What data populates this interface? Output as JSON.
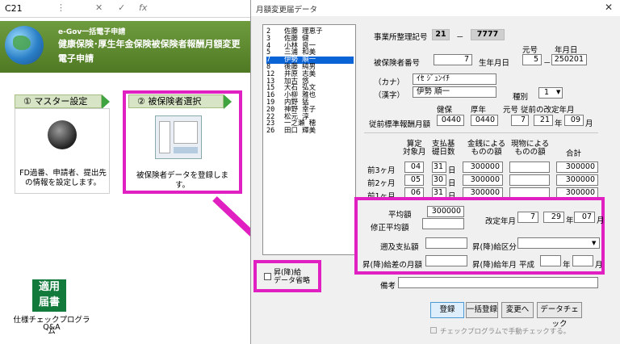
{
  "excel": {
    "cell_ref": "C21",
    "icons": [
      "dropdown-icon",
      "cancel-x-icon",
      "enter-check-icon",
      "function-fx-icon"
    ],
    "icon_glyphs": [
      "⋮",
      "✕",
      "✓",
      "fx"
    ]
  },
  "banner": {
    "line1": "e-Gov一括電子申請",
    "line2": "健康保険･厚生年金保険被保険者報酬月額変更",
    "line3": "電子申請"
  },
  "steps": [
    {
      "label": "① マスター設定",
      "desc": "FD過番、申請者、提出先の情報を設定します。"
    },
    {
      "label": "② 被保険者選択",
      "desc": "被保険者データを登録します。"
    }
  ],
  "kouyou": {
    "line1": "適用",
    "line2": "届書",
    "caption1": "仕様チェックプログラム",
    "caption2": "Q&A"
  },
  "dialog": {
    "title": "月額変更届データ",
    "close": "✕",
    "list": [
      {
        "no": "2",
        "name": "佐藤 理恵子"
      },
      {
        "no": "3",
        "name": "佐藤 健"
      },
      {
        "no": "4",
        "name": "小林 良一"
      },
      {
        "no": "5",
        "name": "三浦 和美"
      },
      {
        "no": "7",
        "name": "伊勢 順一",
        "selected": true
      },
      {
        "no": "8",
        "name": "後藤 純男"
      },
      {
        "no": "12",
        "name": "井原 志美"
      },
      {
        "no": "13",
        "name": "加古 悠"
      },
      {
        "no": "15",
        "name": "大石 弘文"
      },
      {
        "no": "16",
        "name": "小柳 雅也"
      },
      {
        "no": "19",
        "name": "内野 猛"
      },
      {
        "no": "20",
        "name": "神野 幸子"
      },
      {
        "no": "22",
        "name": "松元 淳"
      },
      {
        "no": "23",
        "name": "一之瀬 穂"
      },
      {
        "no": "26",
        "name": "田口 輝美"
      }
    ],
    "office_label": "事業所整理記号",
    "office_code1": "21",
    "office_dash": "－",
    "office_code2": "7777",
    "ins_no_label": "被保険者番号",
    "ins_no": "7",
    "birth_label": "生年月日",
    "era_header": "元号",
    "ymd_header": "年月日",
    "era": "5",
    "dash": "－",
    "birth": "250201",
    "kana_label": "（カナ）",
    "kana": "ｲｾ ｼﾞｭﾝｲﾁ",
    "kanji_label": "（漢字）",
    "kanji": "伊勢 順一",
    "shubetsu_label": "種別",
    "shubetsu": "1",
    "prev_label": "従前標準報酬月額",
    "hdr_kenpo": "健保",
    "hdr_kosei": "厚年",
    "kenpo": "0440",
    "kosei": "0440",
    "hdr_era_change": "元号 従前の改定年月",
    "prev_era": "7",
    "prev_year": "21",
    "nen": "年",
    "prev_month": "09",
    "gatsu": "月",
    "col_month": "算定\n対象月",
    "col_days": "支払基\n礎日数",
    "col_cash": "金銭による\nものの額",
    "col_kind": "現物による\nものの額",
    "col_total": "合計",
    "rows": [
      {
        "label": "前3ヶ月",
        "month": "04",
        "days": "31",
        "day_unit": "日",
        "cash": "300000",
        "kind": "",
        "total": "300000"
      },
      {
        "label": "前2ヶ月",
        "month": "05",
        "days": "30",
        "day_unit": "日",
        "cash": "300000",
        "kind": "",
        "total": "300000"
      },
      {
        "label": "前1ヶ月",
        "month": "06",
        "days": "31",
        "day_unit": "日",
        "cash": "300000",
        "kind": "",
        "total": "300000"
      }
    ],
    "avg_label": "平均額",
    "avg": "300000",
    "mod_avg_label": "修正平均額",
    "mod_avg": "",
    "change_label": "改定年月",
    "change_era": "7",
    "change_year": "29",
    "change_month": "07",
    "retro_label": "遡及支払額",
    "retro": "",
    "raise_type_label": "昇(降)給区分",
    "raise_type": "",
    "raise_diff_label": "昇(降)給差の月額",
    "raise_diff": "",
    "raise_month_label": "昇(降)給年月",
    "heisei": "平成",
    "raise_year": "",
    "raise_month": "",
    "note_label": "備考",
    "note": "",
    "omit_label": "昇(降)給\nデータ省略",
    "buttons": {
      "register": "登録",
      "bulk": "一括登録",
      "change": "変更へ",
      "check": "データチェック"
    },
    "manual_check": "チェックプログラムで手動チェックする。"
  },
  "colors": {
    "highlight": "#e020c0",
    "banner": "#5a8a2e",
    "selection": "#0a64d6"
  }
}
